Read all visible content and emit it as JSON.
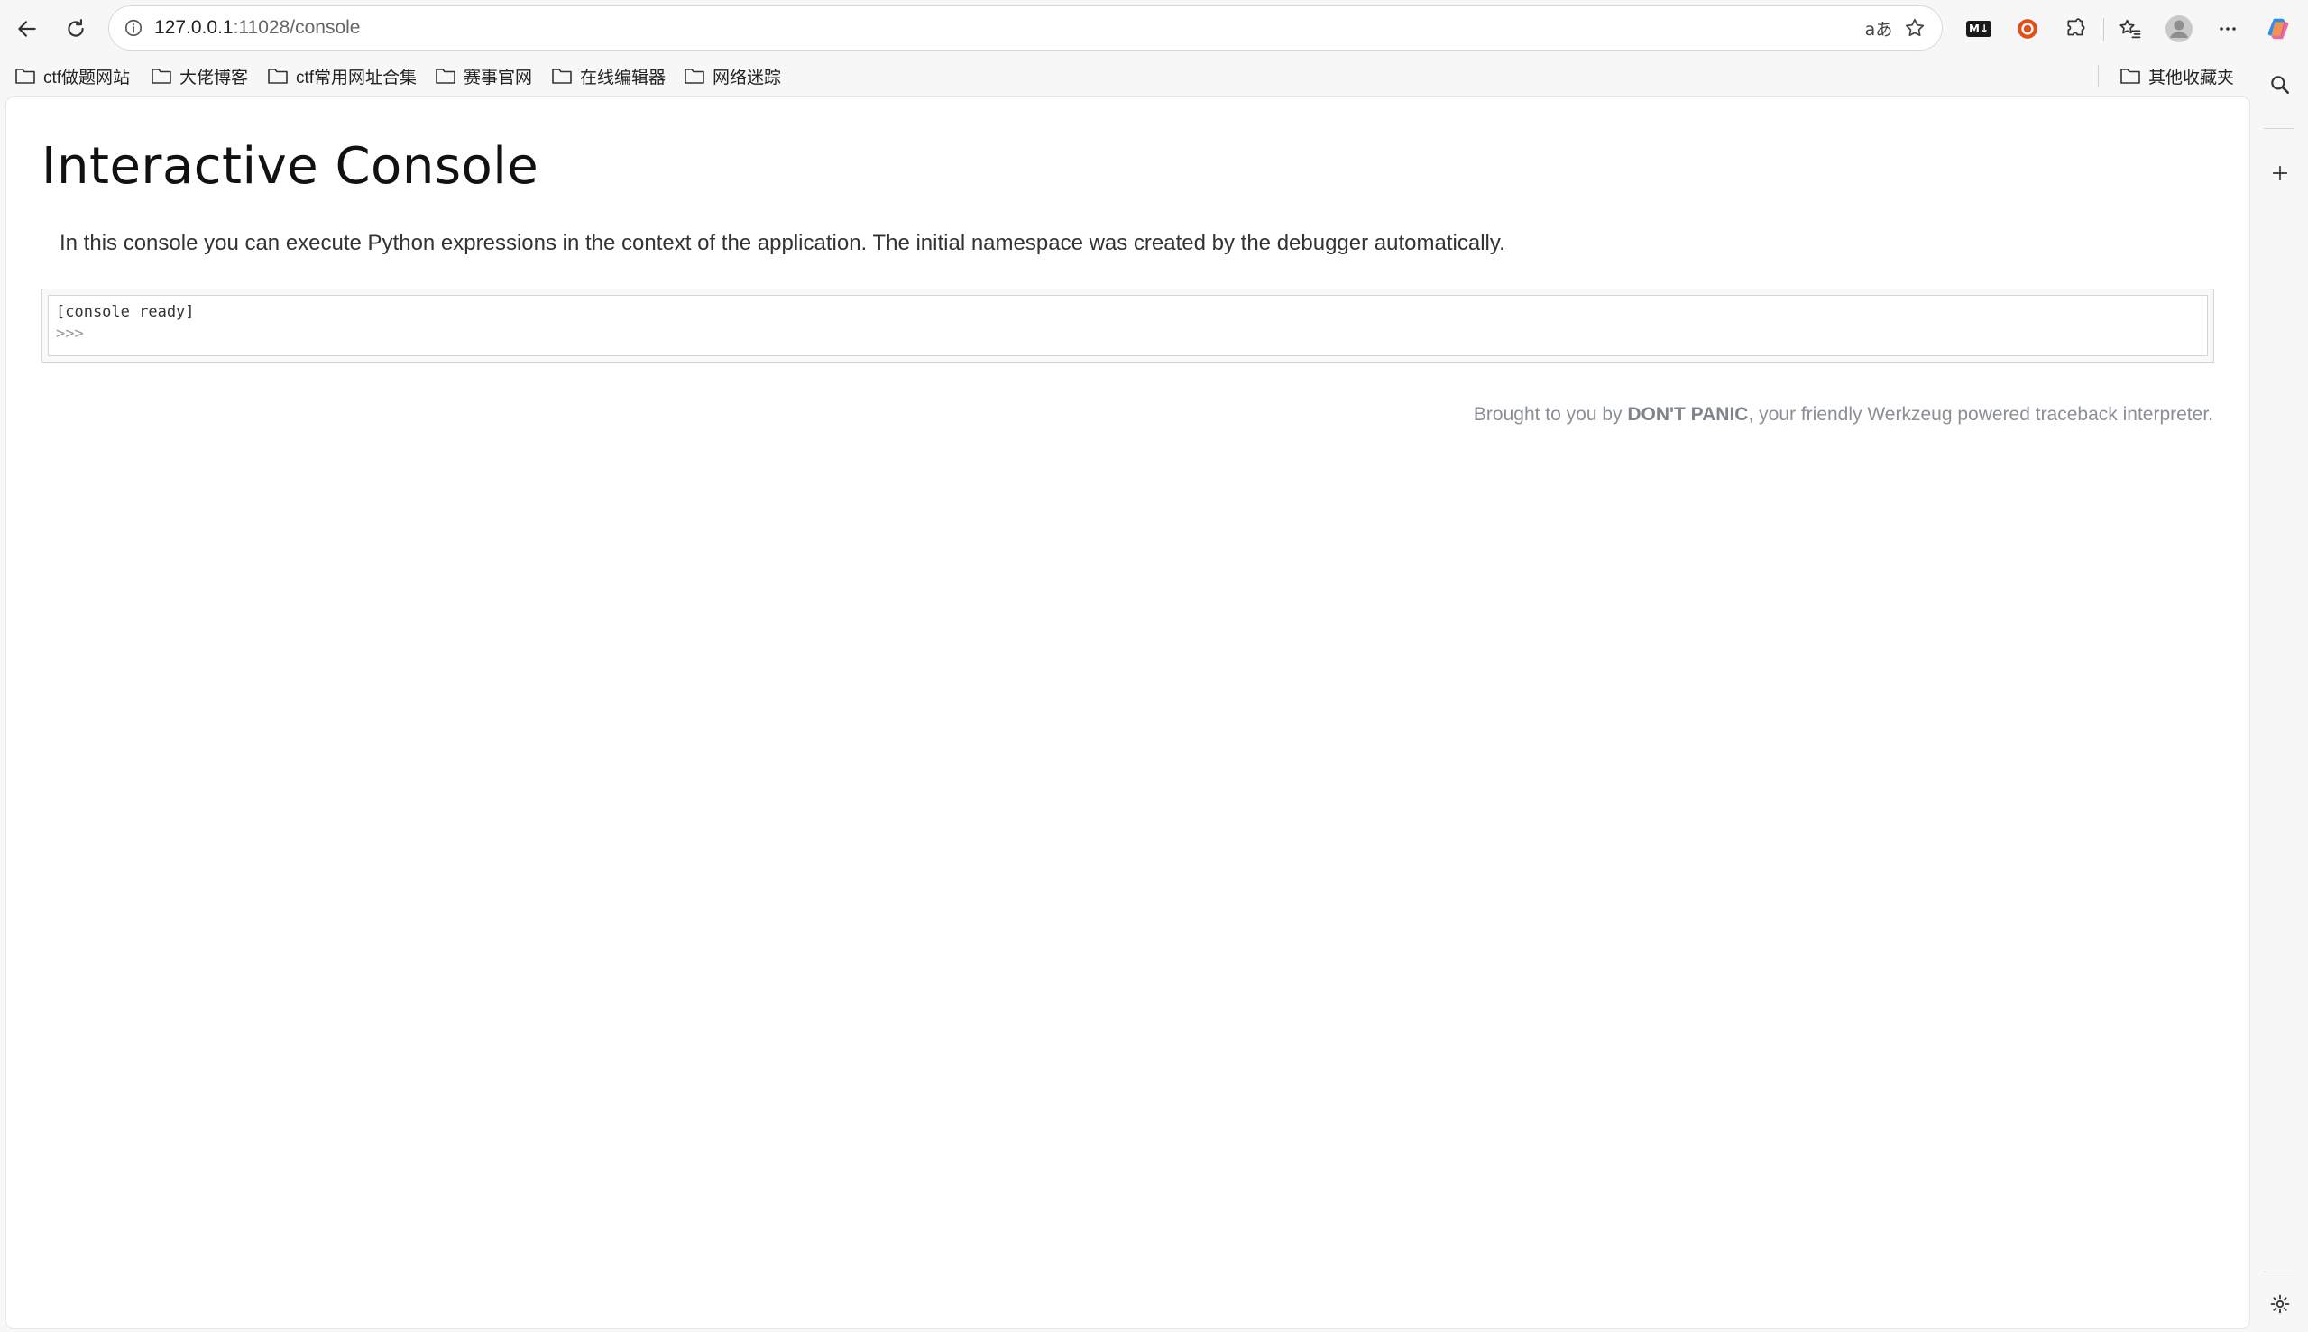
{
  "browser": {
    "url_host": "127.0.0.1",
    "url_rest": ":11028/console",
    "translate_label": "aあ",
    "ext_md_label": "M↓"
  },
  "bookmarks": {
    "items": [
      {
        "label": "ctf做题网站"
      },
      {
        "label": "大佬博客"
      },
      {
        "label": "ctf常用网址合集"
      },
      {
        "label": "赛事官网"
      },
      {
        "label": "在线编辑器"
      },
      {
        "label": "网络迷踪"
      }
    ],
    "other_label": "其他收藏夹"
  },
  "page": {
    "title": "Interactive Console",
    "description": "In this console you can execute Python expressions in the context of the application. The initial namespace was created by the debugger automatically.",
    "console": {
      "ready_text": "[console ready]",
      "prompt": ">>>",
      "input_value": ""
    },
    "footer": {
      "prefix": "Brought to you by ",
      "brand": "DON'T PANIC",
      "suffix": ", your friendly Werkzeug powered traceback interpreter."
    }
  },
  "colors": {
    "accent_orange": "#e0501b",
    "page_bg": "#ffffff",
    "chrome_bg": "#f7f7f7"
  }
}
